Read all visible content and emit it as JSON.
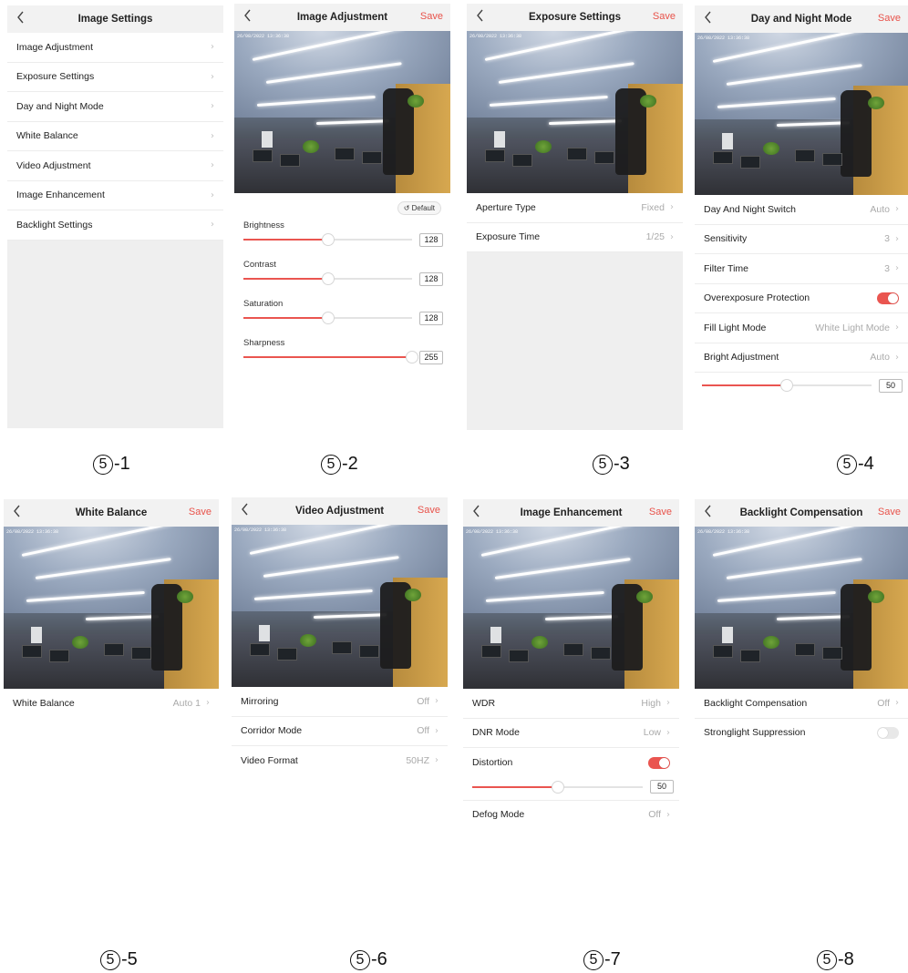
{
  "accent_color": "#ea5550",
  "timestamp": "26/08/2022 13:36:38",
  "back_icon": "chevron-left-icon",
  "chevron": "›",
  "s1": {
    "title": "Image Settings",
    "items": [
      "Image Adjustment",
      "Exposure Settings",
      "Day and Night Mode",
      "White Balance",
      "Video Adjustment",
      "Image Enhancement",
      "Backlight Settings"
    ]
  },
  "s2": {
    "title": "Image Adjustment",
    "save": "Save",
    "default_label": "Default",
    "sliders": [
      {
        "label": "Brightness",
        "value": "128",
        "pct": 0.5
      },
      {
        "label": "Contrast",
        "value": "128",
        "pct": 0.5
      },
      {
        "label": "Saturation",
        "value": "128",
        "pct": 0.5
      },
      {
        "label": "Sharpness",
        "value": "255",
        "pct": 1.0
      }
    ]
  },
  "s3": {
    "title": "Exposure Settings",
    "save": "Save",
    "rows": [
      {
        "label": "Aperture Type",
        "value": "Fixed"
      },
      {
        "label": "Exposure Time",
        "value": "1/25"
      }
    ]
  },
  "s4": {
    "title": "Day and Night Mode",
    "save": "Save",
    "rows": [
      {
        "label": "Day And Night Switch",
        "value": "Auto"
      },
      {
        "label": "Sensitivity",
        "value": "3"
      },
      {
        "label": "Filter Time",
        "value": "3"
      }
    ],
    "overexposure_label": "Overexposure Protection",
    "overexposure_on": true,
    "rows2": [
      {
        "label": "Fill Light Mode",
        "value": "White Light Mode"
      },
      {
        "label": "Bright Adjustment",
        "value": "Auto"
      }
    ],
    "slider": {
      "value": "50",
      "pct": 0.5
    }
  },
  "s5": {
    "title": "White Balance",
    "save": "Save",
    "rows": [
      {
        "label": "White Balance",
        "value": "Auto 1"
      }
    ]
  },
  "s6": {
    "title": "Video Adjustment",
    "save": "Save",
    "rows": [
      {
        "label": "Mirroring",
        "value": "Off"
      },
      {
        "label": "Corridor Mode",
        "value": "Off"
      },
      {
        "label": "Video Format",
        "value": "50HZ"
      }
    ]
  },
  "s7": {
    "title": "Image Enhancement",
    "save": "Save",
    "rows": [
      {
        "label": "WDR",
        "value": "High"
      },
      {
        "label": "DNR Mode",
        "value": "Low"
      }
    ],
    "distortion_label": "Distortion",
    "distortion_on": true,
    "slider": {
      "value": "50",
      "pct": 0.5
    },
    "rows2": [
      {
        "label": "Defog Mode",
        "value": "Off"
      }
    ]
  },
  "s8": {
    "title": "Backlight Compensation",
    "save": "Save",
    "rows": [
      {
        "label": "Backlight Compensation",
        "value": "Off"
      }
    ],
    "suppression_label": "Stronglight Suppression",
    "suppression_on": false
  },
  "captions": [
    {
      "num": "5",
      "suffix": "-1"
    },
    {
      "num": "5",
      "suffix": "-2"
    },
    {
      "num": "5",
      "suffix": "-3"
    },
    {
      "num": "5",
      "suffix": "-4"
    },
    {
      "num": "5",
      "suffix": "-5"
    },
    {
      "num": "5",
      "suffix": "-6"
    },
    {
      "num": "5",
      "suffix": "-7"
    },
    {
      "num": "5",
      "suffix": "-8"
    }
  ]
}
